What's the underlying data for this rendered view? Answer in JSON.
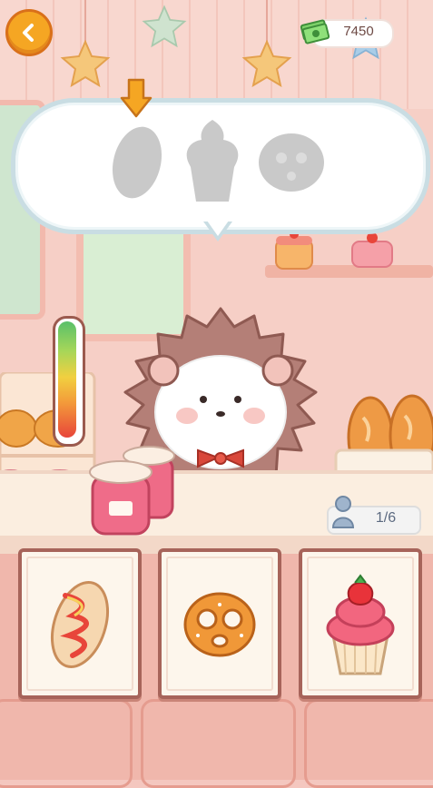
{
  "hud": {
    "money": "7450",
    "customers_served": "1/6"
  },
  "order": {
    "items": [
      "oval-bread",
      "cupcake",
      "pretzel"
    ]
  },
  "patience_meter": {
    "level": 1.0
  },
  "cards": [
    {
      "name": "bread-card",
      "item": "strawberry-glazed-bread"
    },
    {
      "name": "pretzel-card",
      "item": "pretzel"
    },
    {
      "name": "cupcake-card",
      "item": "strawberry-cupcake"
    }
  ],
  "colors": {
    "accent": "#f5a623",
    "bubble_border": "#c9dde3",
    "card_border": "#a7645a",
    "wall": "#f6cfc6"
  }
}
